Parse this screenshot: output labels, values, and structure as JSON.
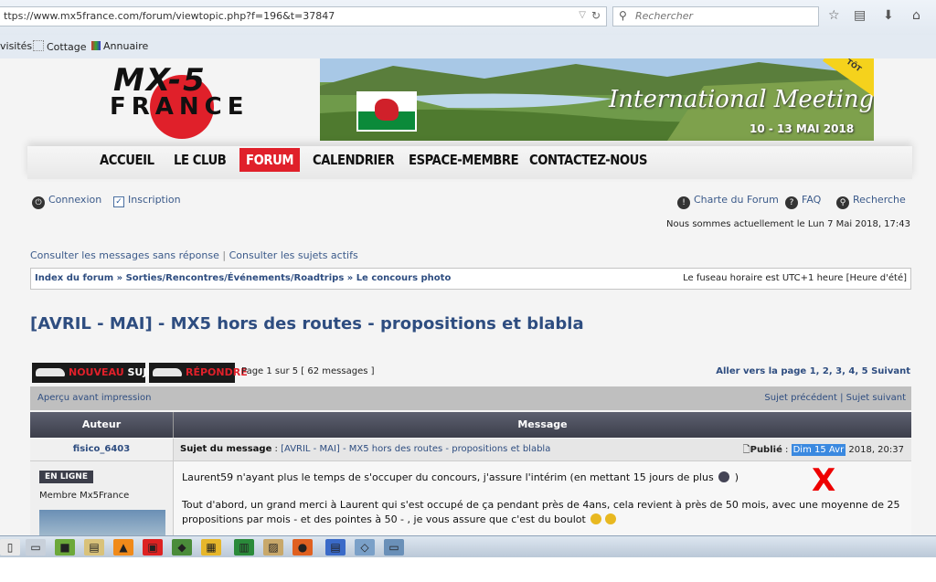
{
  "browser": {
    "url": "ttps://www.mx5france.com/forum/viewtopic.php?f=196&t=37847",
    "search_placeholder": "Rechercher",
    "bookmarks": [
      "visités",
      "Cottage",
      "Annuaire"
    ]
  },
  "header": {
    "logo_top": "MX-5",
    "logo_bottom": "FRANCE",
    "banner_title": "International Meeting",
    "banner_dates": "10 - 13 MAI 2018",
    "banner_corner": "TÔT"
  },
  "menu": [
    "ACCUEIL",
    "LE CLUB",
    "FORUM",
    "CALENDRIER",
    "ESPACE-MEMBRE",
    "CONTACTEZ-NOUS"
  ],
  "userbar": {
    "login": "Connexion",
    "register": "Inscription",
    "charter": "Charte du Forum",
    "faq": "FAQ",
    "search": "Recherche"
  },
  "datetime": "Nous sommes actuellement le Lun 7 Mai 2018, 17:43",
  "quicklinks": {
    "unanswered": "Consulter les messages sans réponse",
    "sep": "|",
    "active": "Consulter les sujets actifs"
  },
  "breadcrumb": {
    "path": "Index du forum » Sorties/Rencontres/Événements/Roadtrips » Le concours photo",
    "timezone": "Le fuseau horaire est UTC+1 heure [Heure d'été]"
  },
  "topic": {
    "title": "[AVRIL - MAI] - MX5 hors des routes - propositions et blabla",
    "new_topic_a": "NOUVEAU",
    "new_topic_b": "SUJET",
    "reply": "RÉPONDRE",
    "page_info": "Page 1 sur 5  [ 62 messages ]",
    "pager": "Aller vers la page 1, 2, 3, 4, 5  Suivant",
    "print": "Aperçu avant impression",
    "nav": "Sujet précédent | Sujet suivant"
  },
  "table": {
    "col_author": "Auteur",
    "col_message": "Message"
  },
  "post": {
    "author": "fisico_6403",
    "subject_label": "Sujet du message",
    "subject": "[AVRIL - MAI] - MX5 hors des routes - propositions et blabla",
    "published_label": "Publié",
    "published_highlight": "Dim 15 Avr",
    "published_rest": "2018, 20:37",
    "status": "EN LIGNE",
    "rank": "Membre Mx5France",
    "p1": "Laurent59 n'ayant plus le temps de s'occuper du concours, j'assure l'intérim (en mettant 15 jours de plus",
    "p1_end": ")",
    "p2": "Tout d'abord, un grand merci à Laurent qui s'est occupé de ça pendant près de 4ans, cela revient à près de 50 mois, avec une moyenne de 25 propositions par mois - et des pointes à 50 - , je vous assure que c'est du boulot",
    "annotation": "X"
  },
  "colors": {
    "accent_red": "#e0202a",
    "link_blue": "#2e4d80",
    "header_dark": "#3c3e4a"
  }
}
